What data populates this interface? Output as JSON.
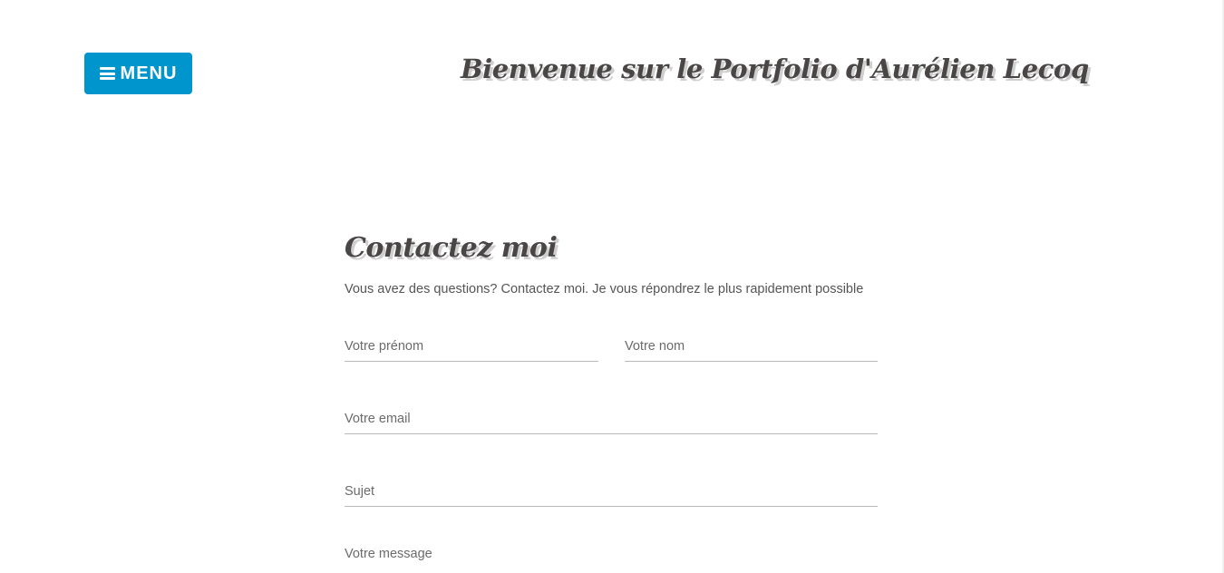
{
  "header": {
    "menu_label": "MENU",
    "menu_icon": "hamburger-menu-icon",
    "site_title": "Bienvenue sur le Portfolio d'Aurélien Lecoq"
  },
  "contact": {
    "title": "Contactez moi",
    "intro": "Vous avez des questions? Contactez moi. Je vous répondrez le plus rapidement possible",
    "fields": {
      "firstname_placeholder": "Votre prénom",
      "lastname_placeholder": "Votre nom",
      "email_placeholder": "Votre email",
      "subject_placeholder": "Sujet",
      "message_placeholder": "Votre message"
    }
  },
  "colors": {
    "menu_button": "#0095cd",
    "title_text": "#4a4646",
    "title_shadow": "#cfcfcf",
    "body_text": "#555555",
    "field_line": "#b9b9b9"
  }
}
